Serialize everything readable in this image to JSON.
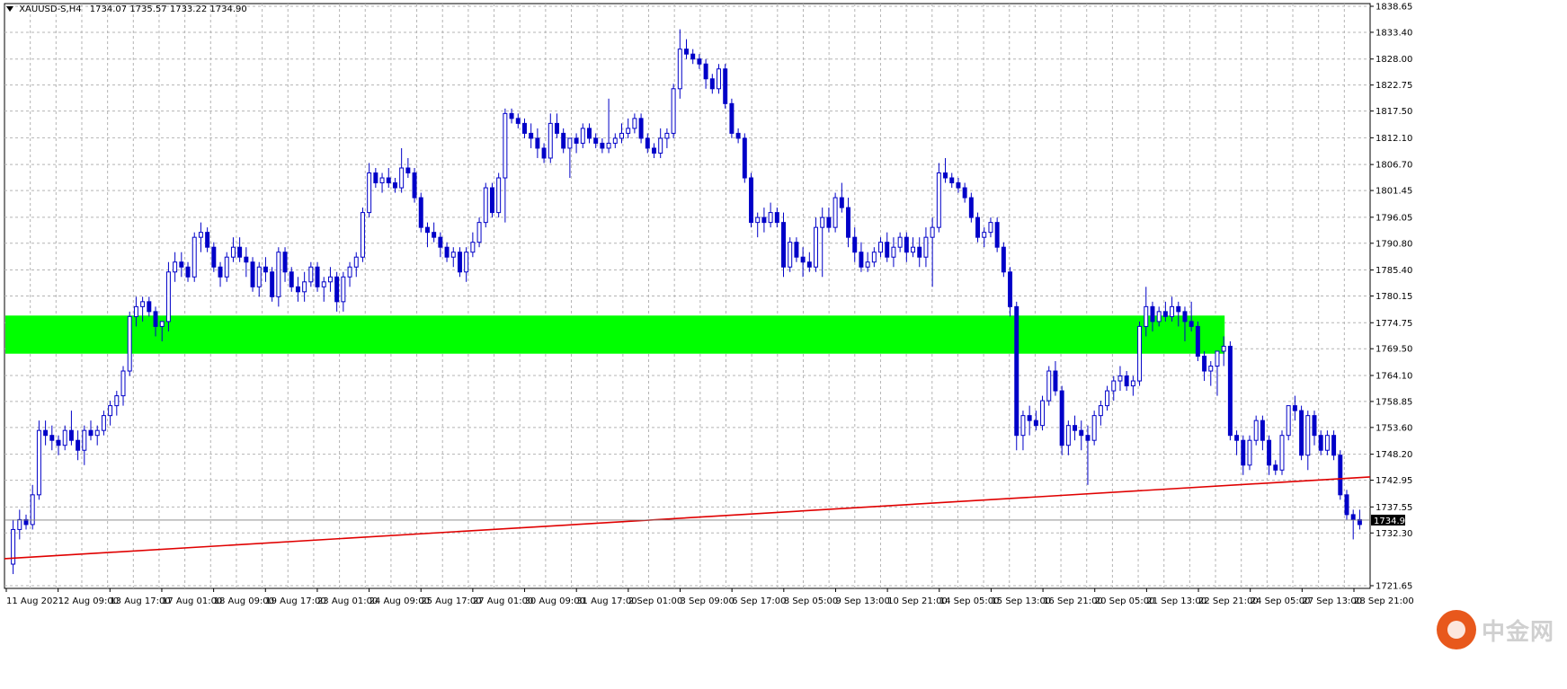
{
  "header": {
    "symbol": "XAUUSD-S,H4",
    "ohlc": "1734.07 1735.57 1733.22 1734.90"
  },
  "price_axis": {
    "labels": [
      "1838.65",
      "1833.40",
      "1828.00",
      "1822.75",
      "1817.50",
      "1812.10",
      "1806.70",
      "1801.45",
      "1796.05",
      "1790.80",
      "1785.40",
      "1780.15",
      "1774.75",
      "1769.50",
      "1764.10",
      "1758.85",
      "1753.60",
      "1748.20",
      "1742.95",
      "1737.55",
      "1732.30",
      "1721.65"
    ],
    "current_price": "1734.90"
  },
  "time_axis": {
    "labels": [
      "11 Aug 2021",
      "12 Aug 09:00",
      "13 Aug 17:00",
      "17 Aug 01:00",
      "18 Aug 09:00",
      "19 Aug 17:00",
      "23 Aug 01:00",
      "24 Aug 09:00",
      "25 Aug 17:00",
      "27 Aug 01:00",
      "30 Aug 09:00",
      "31 Aug 17:00",
      "2 Sep 01:00",
      "3 Sep 09:00",
      "6 Sep 17:00",
      "8 Sep 05:00",
      "9 Sep 13:00",
      "10 Sep 21:00",
      "14 Sep 05:00",
      "15 Sep 13:00",
      "16 Sep 21:00",
      "20 Sep 05:00",
      "21 Sep 13:00",
      "22 Sep 21:00",
      "24 Sep 05:00",
      "27 Sep 13:00",
      "28 Sep 21:00"
    ]
  },
  "watermark": {
    "text": "中金网"
  },
  "colors": {
    "candle": "#0000c8",
    "zone": "#00ff00",
    "trendline": "#e00000",
    "grid": "#b4b4b4",
    "background": "#ffffff"
  },
  "chart_data": {
    "type": "candlestick",
    "symbol": "XAUUSD-S",
    "timeframe": "H4",
    "ylim": [
      1721.65,
      1838.65
    ],
    "grid": true,
    "candles": [
      [
        1726,
        1735,
        1724,
        1733
      ],
      [
        1733,
        1737,
        1731,
        1735
      ],
      [
        1735,
        1736,
        1733,
        1734
      ],
      [
        1734,
        1742,
        1733,
        1740
      ],
      [
        1740,
        1755,
        1739,
        1753
      ],
      [
        1753,
        1755,
        1750,
        1752
      ],
      [
        1752,
        1754,
        1749,
        1751
      ],
      [
        1751,
        1752,
        1748,
        1750
      ],
      [
        1750,
        1754,
        1749,
        1753
      ],
      [
        1753,
        1757,
        1750,
        1751
      ],
      [
        1751,
        1753,
        1747,
        1749
      ],
      [
        1749,
        1754,
        1746,
        1753
      ],
      [
        1753,
        1755,
        1751,
        1752
      ],
      [
        1752,
        1754,
        1750,
        1753
      ],
      [
        1753,
        1757,
        1752,
        1756
      ],
      [
        1756,
        1759,
        1754,
        1758
      ],
      [
        1758,
        1761,
        1756,
        1760
      ],
      [
        1760,
        1766,
        1758,
        1765
      ],
      [
        1765,
        1777,
        1764,
        1776
      ],
      [
        1776,
        1780,
        1774,
        1778
      ],
      [
        1778,
        1780,
        1775,
        1779
      ],
      [
        1779,
        1780,
        1776,
        1777
      ],
      [
        1777,
        1778,
        1772,
        1774
      ],
      [
        1774,
        1775,
        1771,
        1775
      ],
      [
        1775,
        1787,
        1773,
        1785
      ],
      [
        1785,
        1789,
        1783,
        1787
      ],
      [
        1787,
        1789,
        1784,
        1786
      ],
      [
        1786,
        1787,
        1783,
        1784
      ],
      [
        1784,
        1793,
        1783,
        1792
      ],
      [
        1792,
        1795,
        1789,
        1793
      ],
      [
        1793,
        1794,
        1789,
        1790
      ],
      [
        1790,
        1791,
        1785,
        1786
      ],
      [
        1786,
        1787,
        1782,
        1784
      ],
      [
        1784,
        1789,
        1783,
        1788
      ],
      [
        1788,
        1792,
        1787,
        1790
      ],
      [
        1790,
        1792,
        1787,
        1788
      ],
      [
        1788,
        1790,
        1784,
        1787
      ],
      [
        1787,
        1788,
        1781,
        1782
      ],
      [
        1782,
        1787,
        1780,
        1786
      ],
      [
        1786,
        1788,
        1783,
        1785
      ],
      [
        1785,
        1786,
        1779,
        1780
      ],
      [
        1780,
        1790,
        1778,
        1789
      ],
      [
        1789,
        1790,
        1783,
        1785
      ],
      [
        1785,
        1786,
        1781,
        1782
      ],
      [
        1782,
        1784,
        1779,
        1781
      ],
      [
        1781,
        1785,
        1779,
        1783
      ],
      [
        1783,
        1787,
        1782,
        1786
      ],
      [
        1786,
        1787,
        1781,
        1782
      ],
      [
        1782,
        1784,
        1779,
        1783
      ],
      [
        1783,
        1786,
        1781,
        1784
      ],
      [
        1784,
        1785,
        1777,
        1779
      ],
      [
        1779,
        1785,
        1777,
        1784
      ],
      [
        1784,
        1787,
        1782,
        1786
      ],
      [
        1786,
        1789,
        1784,
        1788
      ],
      [
        1788,
        1798,
        1787,
        1797
      ],
      [
        1797,
        1807,
        1796,
        1805
      ],
      [
        1805,
        1806,
        1802,
        1803
      ],
      [
        1803,
        1805,
        1801,
        1804
      ],
      [
        1804,
        1806,
        1802,
        1803
      ],
      [
        1803,
        1804,
        1801,
        1802
      ],
      [
        1802,
        1810,
        1801,
        1806
      ],
      [
        1806,
        1808,
        1804,
        1805
      ],
      [
        1805,
        1806,
        1799,
        1800
      ],
      [
        1800,
        1801,
        1793,
        1794
      ],
      [
        1794,
        1795,
        1790,
        1793
      ],
      [
        1793,
        1795,
        1791,
        1792
      ],
      [
        1792,
        1793,
        1788,
        1790
      ],
      [
        1790,
        1791,
        1787,
        1788
      ],
      [
        1788,
        1790,
        1786,
        1789
      ],
      [
        1789,
        1790,
        1784,
        1785
      ],
      [
        1785,
        1790,
        1783,
        1789
      ],
      [
        1789,
        1793,
        1788,
        1791
      ],
      [
        1791,
        1796,
        1790,
        1795
      ],
      [
        1795,
        1803,
        1794,
        1802
      ],
      [
        1802,
        1803,
        1796,
        1797
      ],
      [
        1797,
        1805,
        1796,
        1804
      ],
      [
        1804,
        1818,
        1795,
        1817
      ],
      [
        1817,
        1818,
        1815,
        1816
      ],
      [
        1816,
        1817,
        1814,
        1815
      ],
      [
        1815,
        1816,
        1812,
        1813
      ],
      [
        1813,
        1815,
        1810,
        1812
      ],
      [
        1812,
        1814,
        1808,
        1810
      ],
      [
        1810,
        1811,
        1807,
        1808
      ],
      [
        1808,
        1817,
        1807,
        1815
      ],
      [
        1815,
        1817,
        1812,
        1813
      ],
      [
        1813,
        1814,
        1809,
        1810
      ],
      [
        1810,
        1811,
        1804,
        1812
      ],
      [
        1812,
        1813,
        1809,
        1811
      ],
      [
        1811,
        1815,
        1810,
        1814
      ],
      [
        1814,
        1815,
        1811,
        1812
      ],
      [
        1812,
        1813,
        1810,
        1811
      ],
      [
        1811,
        1812,
        1809,
        1810
      ],
      [
        1810,
        1820,
        1809,
        1811
      ],
      [
        1811,
        1813,
        1810,
        1812
      ],
      [
        1812,
        1815,
        1811,
        1813
      ],
      [
        1813,
        1816,
        1812,
        1814
      ],
      [
        1814,
        1817,
        1813,
        1816
      ],
      [
        1816,
        1817,
        1811,
        1812
      ],
      [
        1812,
        1813,
        1809,
        1810
      ],
      [
        1810,
        1811,
        1808,
        1809
      ],
      [
        1809,
        1814,
        1808,
        1812
      ],
      [
        1812,
        1814,
        1810,
        1813
      ],
      [
        1813,
        1823,
        1812,
        1822
      ],
      [
        1822,
        1834,
        1820,
        1830
      ],
      [
        1830,
        1832,
        1828,
        1829
      ],
      [
        1829,
        1830,
        1827,
        1828
      ],
      [
        1828,
        1829,
        1826,
        1827
      ],
      [
        1827,
        1828,
        1822,
        1824
      ],
      [
        1824,
        1825,
        1821,
        1822
      ],
      [
        1822,
        1827,
        1821,
        1826
      ],
      [
        1826,
        1827,
        1818,
        1819
      ],
      [
        1819,
        1820,
        1812,
        1813
      ],
      [
        1813,
        1814,
        1811,
        1812
      ],
      [
        1812,
        1813,
        1803,
        1804
      ],
      [
        1804,
        1805,
        1794,
        1795
      ],
      [
        1795,
        1797,
        1792,
        1796
      ],
      [
        1796,
        1798,
        1793,
        1795
      ],
      [
        1795,
        1799,
        1794,
        1797
      ],
      [
        1797,
        1798,
        1794,
        1795
      ],
      [
        1795,
        1797,
        1784,
        1786
      ],
      [
        1786,
        1792,
        1785,
        1791
      ],
      [
        1791,
        1792,
        1787,
        1788
      ],
      [
        1788,
        1790,
        1784,
        1787
      ],
      [
        1787,
        1789,
        1785,
        1786
      ],
      [
        1786,
        1796,
        1785,
        1794
      ],
      [
        1794,
        1798,
        1784,
        1796
      ],
      [
        1796,
        1798,
        1793,
        1794
      ],
      [
        1794,
        1801,
        1793,
        1800
      ],
      [
        1800,
        1803,
        1797,
        1798
      ],
      [
        1798,
        1800,
        1790,
        1792
      ],
      [
        1792,
        1794,
        1787,
        1789
      ],
      [
        1789,
        1791,
        1785,
        1786
      ],
      [
        1786,
        1789,
        1785,
        1787
      ],
      [
        1787,
        1790,
        1786,
        1789
      ],
      [
        1789,
        1792,
        1788,
        1791
      ],
      [
        1791,
        1793,
        1787,
        1788
      ],
      [
        1788,
        1792,
        1786,
        1790
      ],
      [
        1790,
        1793,
        1789,
        1792
      ],
      [
        1792,
        1793,
        1787,
        1789
      ],
      [
        1789,
        1792,
        1788,
        1790
      ],
      [
        1790,
        1792,
        1786,
        1788
      ],
      [
        1788,
        1794,
        1786,
        1792
      ],
      [
        1792,
        1796,
        1782,
        1794
      ],
      [
        1794,
        1807,
        1793,
        1805
      ],
      [
        1805,
        1808,
        1803,
        1804
      ],
      [
        1804,
        1805,
        1802,
        1803
      ],
      [
        1803,
        1804,
        1801,
        1802
      ],
      [
        1802,
        1803,
        1799,
        1800
      ],
      [
        1800,
        1801,
        1795,
        1796
      ],
      [
        1796,
        1797,
        1791,
        1792
      ],
      [
        1792,
        1794,
        1790,
        1793
      ],
      [
        1793,
        1796,
        1792,
        1795
      ],
      [
        1795,
        1796,
        1789,
        1790
      ],
      [
        1790,
        1791,
        1784,
        1785
      ],
      [
        1785,
        1786,
        1776,
        1778
      ],
      [
        1778,
        1779,
        1749,
        1752
      ],
      [
        1752,
        1757,
        1749,
        1756
      ],
      [
        1756,
        1758,
        1752,
        1755
      ],
      [
        1755,
        1757,
        1753,
        1754
      ],
      [
        1754,
        1760,
        1753,
        1759
      ],
      [
        1759,
        1766,
        1758,
        1765
      ],
      [
        1765,
        1767,
        1760,
        1761
      ],
      [
        1761,
        1762,
        1748,
        1750
      ],
      [
        1750,
        1755,
        1748,
        1754
      ],
      [
        1754,
        1756,
        1751,
        1753
      ],
      [
        1753,
        1755,
        1749,
        1752
      ],
      [
        1752,
        1754,
        1742,
        1751
      ],
      [
        1751,
        1757,
        1750,
        1756
      ],
      [
        1756,
        1759,
        1754,
        1758
      ],
      [
        1758,
        1762,
        1757,
        1761
      ],
      [
        1761,
        1764,
        1759,
        1763
      ],
      [
        1763,
        1766,
        1761,
        1764
      ],
      [
        1764,
        1765,
        1761,
        1762
      ],
      [
        1762,
        1764,
        1760,
        1763
      ],
      [
        1763,
        1775,
        1762,
        1774
      ],
      [
        1774,
        1782,
        1772,
        1778
      ],
      [
        1778,
        1779,
        1773,
        1775
      ],
      [
        1775,
        1778,
        1774,
        1777
      ],
      [
        1777,
        1779,
        1775,
        1776
      ],
      [
        1776,
        1780,
        1775,
        1778
      ],
      [
        1778,
        1779,
        1774,
        1777
      ],
      [
        1777,
        1778,
        1771,
        1775
      ],
      [
        1775,
        1779,
        1773,
        1774
      ],
      [
        1774,
        1775,
        1767,
        1768
      ],
      [
        1768,
        1769,
        1763,
        1765
      ],
      [
        1765,
        1767,
        1762,
        1766
      ],
      [
        1766,
        1768,
        1760,
        1769
      ],
      [
        1769,
        1772,
        1766,
        1770
      ],
      [
        1770,
        1771,
        1751,
        1752
      ],
      [
        1752,
        1753,
        1748,
        1751
      ],
      [
        1751,
        1752,
        1744,
        1746
      ],
      [
        1746,
        1752,
        1745,
        1751
      ],
      [
        1751,
        1756,
        1750,
        1755
      ],
      [
        1755,
        1756,
        1749,
        1751
      ],
      [
        1751,
        1752,
        1744,
        1746
      ],
      [
        1746,
        1747,
        1744,
        1745
      ],
      [
        1745,
        1753,
        1744,
        1752
      ],
      [
        1752,
        1758,
        1751,
        1758
      ],
      [
        1758,
        1760,
        1755,
        1757
      ],
      [
        1757,
        1758,
        1747,
        1748
      ],
      [
        1748,
        1757,
        1745,
        1756
      ],
      [
        1756,
        1757,
        1750,
        1752
      ],
      [
        1752,
        1753,
        1748,
        1749
      ],
      [
        1749,
        1753,
        1748,
        1752
      ],
      [
        1752,
        1753,
        1747,
        1748
      ],
      [
        1748,
        1749,
        1739,
        1740
      ],
      [
        1740,
        1741,
        1735,
        1736
      ],
      [
        1736,
        1737,
        1731,
        1735
      ],
      [
        1735,
        1737,
        1733,
        1734
      ]
    ],
    "zone": {
      "from": 1768.5,
      "to": 1776.2,
      "color": "#00ff00"
    },
    "trendline": {
      "start_index": 0,
      "start_price": 1727.2,
      "end_index": 226,
      "end_price": 1744.9,
      "color": "#e00000"
    },
    "last_price": 1734.9
  }
}
